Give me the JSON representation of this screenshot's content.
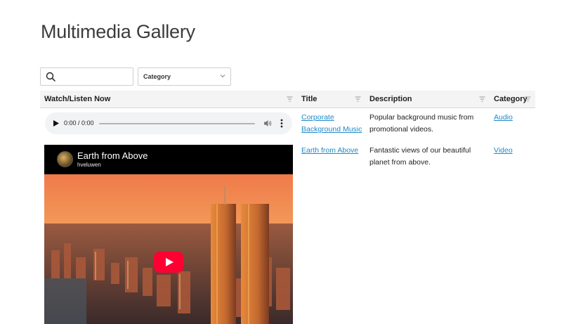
{
  "page": {
    "title": "Multimedia Gallery"
  },
  "filters": {
    "search_placeholder": "",
    "search_value": "",
    "category_label": "Category"
  },
  "table": {
    "columns": [
      "Watch/Listen Now",
      "Title",
      "Description",
      "Category"
    ],
    "rows": [
      {
        "media_type": "audio",
        "player": {
          "time": "0:00 / 0:00"
        },
        "title": "Corporate Background Music",
        "title_lines": [
          "Corporate",
          "Background Music"
        ],
        "description_lines": [
          "Popular background music from",
          "promotional videos."
        ],
        "category": "Audio"
      },
      {
        "media_type": "video",
        "player": {
          "video_title": "Earth from Above",
          "channel": "hveluwen"
        },
        "title": "Earth from Above",
        "description_lines": [
          "Fantastic views of our beautiful",
          "planet from above."
        ],
        "category": "Video"
      }
    ]
  },
  "colors": {
    "link": "#1d89c9",
    "play_button": "#ff0033",
    "header_bg": "#f4f4f4"
  },
  "icons": [
    "search-icon",
    "chevron-down-icon",
    "sort-icon",
    "play-icon",
    "volume-icon",
    "more-vert-icon",
    "youtube-play-icon"
  ]
}
